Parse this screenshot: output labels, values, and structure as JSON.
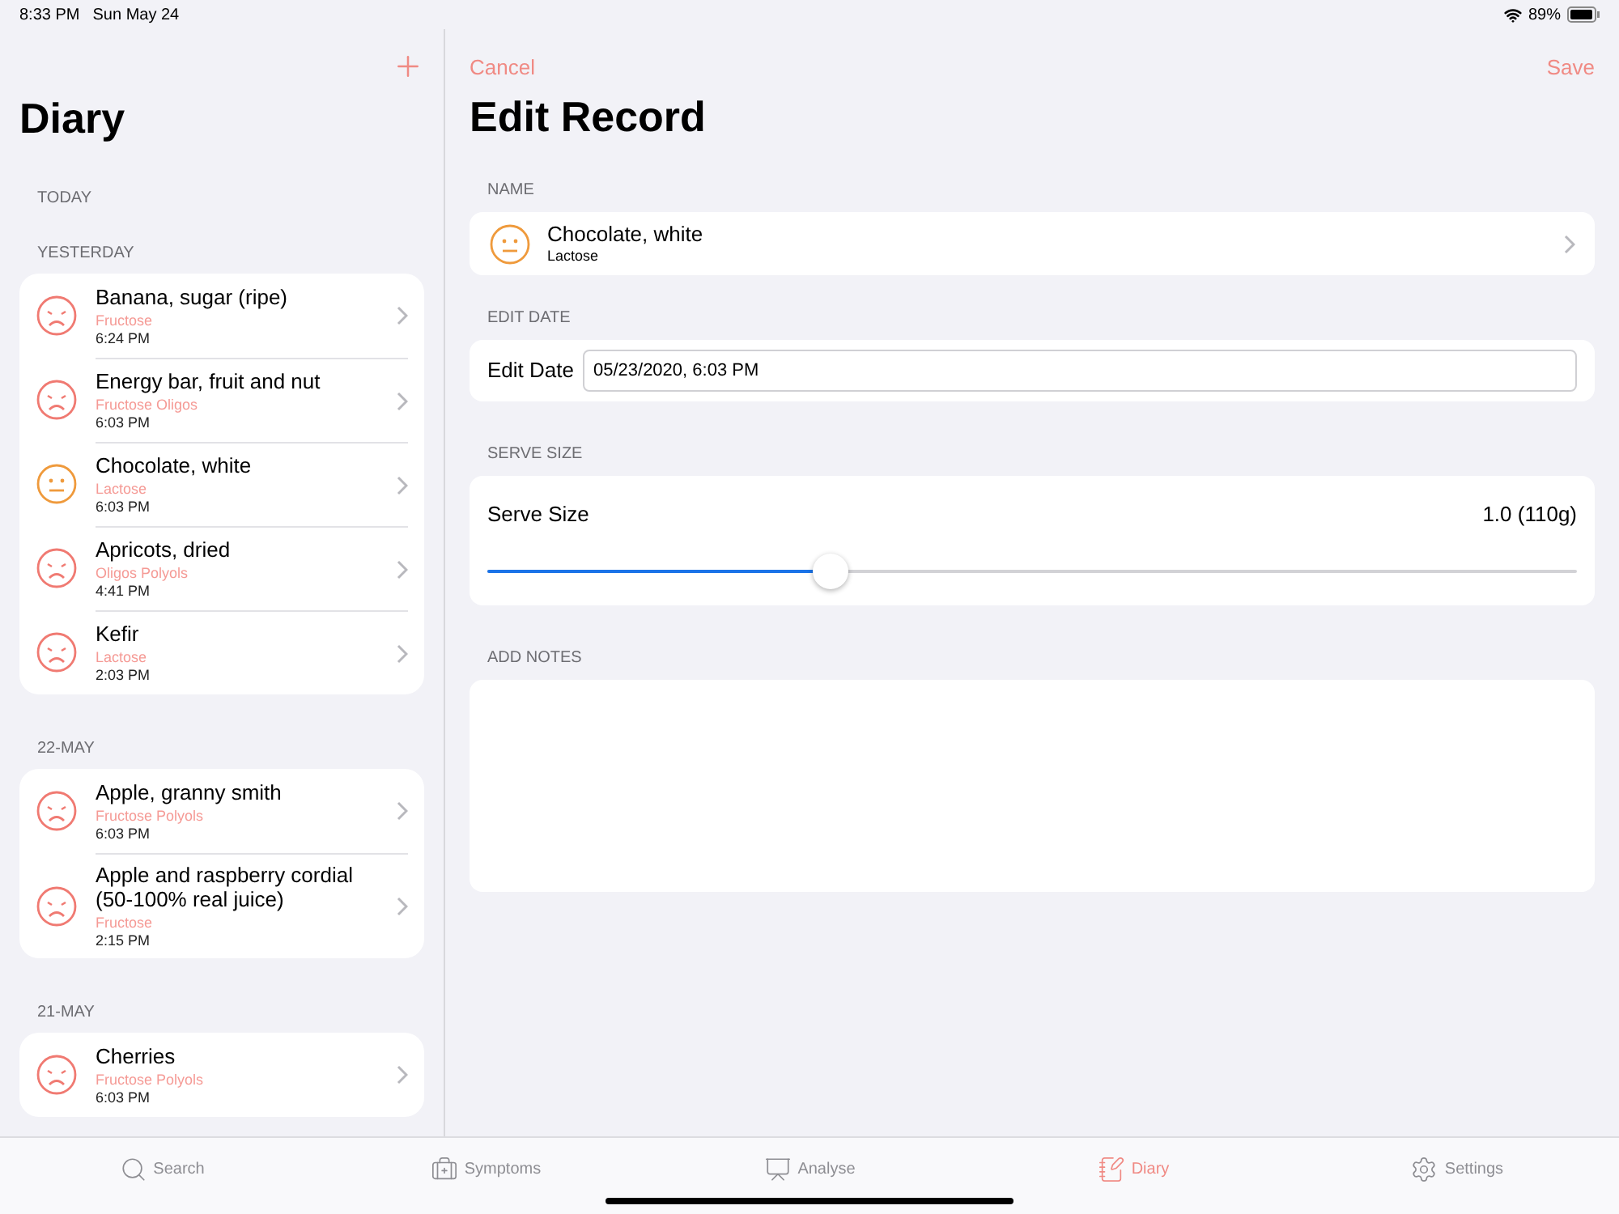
{
  "status_bar": {
    "time": "8:33 PM",
    "date": "Sun May 24",
    "battery": "89%"
  },
  "sidebar": {
    "title": "Diary",
    "sections": [
      {
        "header": "TODAY"
      },
      {
        "header": "YESTERDAY",
        "items": [
          {
            "name": "Banana, sugar (ripe)",
            "tags": "Fructose",
            "time": "6:24 PM",
            "kind": "sad"
          },
          {
            "name": "Energy bar, fruit and nut",
            "tags": "Fructose Oligos",
            "time": "6:03 PM",
            "kind": "sad"
          },
          {
            "name": "Chocolate, white",
            "tags": "Lactose",
            "time": "6:03 PM",
            "kind": "neutral"
          },
          {
            "name": "Apricots, dried",
            "tags": "Oligos Polyols",
            "time": "4:41 PM",
            "kind": "sad"
          },
          {
            "name": "Kefir",
            "tags": "Lactose",
            "time": "2:03 PM",
            "kind": "sad"
          }
        ]
      },
      {
        "header": "22-MAY",
        "items": [
          {
            "name": "Apple, granny smith",
            "tags": "Fructose Polyols",
            "time": "6:03 PM",
            "kind": "sad"
          },
          {
            "name": "Apple and raspberry cordial (50-100% real juice)",
            "tags": "Fructose",
            "time": "2:15 PM",
            "kind": "sad"
          }
        ]
      },
      {
        "header": "21-MAY",
        "items": [
          {
            "name": "Cherries",
            "tags": "Fructose Polyols",
            "time": "6:03 PM",
            "kind": "sad"
          }
        ]
      }
    ]
  },
  "detail": {
    "cancel": "Cancel",
    "save": "Save",
    "title": "Edit Record",
    "name_section": {
      "header": "NAME",
      "name": "Chocolate, white",
      "tags": "Lactose",
      "kind": "neutral"
    },
    "date_section": {
      "header": "EDIT DATE",
      "label": "Edit Date",
      "value": "05/23/2020, 6:03 PM"
    },
    "serve_section": {
      "header": "SERVE SIZE",
      "label": "Serve Size",
      "reading": "1.0 (110g)",
      "level": 0.315
    },
    "notes_section": {
      "header": "ADD NOTES"
    }
  },
  "tab_bar": [
    {
      "label": "Search",
      "selected": false
    },
    {
      "label": "Symptoms",
      "selected": false
    },
    {
      "label": "Analyse",
      "selected": false
    },
    {
      "label": "Diary",
      "selected": true
    },
    {
      "label": "Settings",
      "selected": false
    }
  ]
}
